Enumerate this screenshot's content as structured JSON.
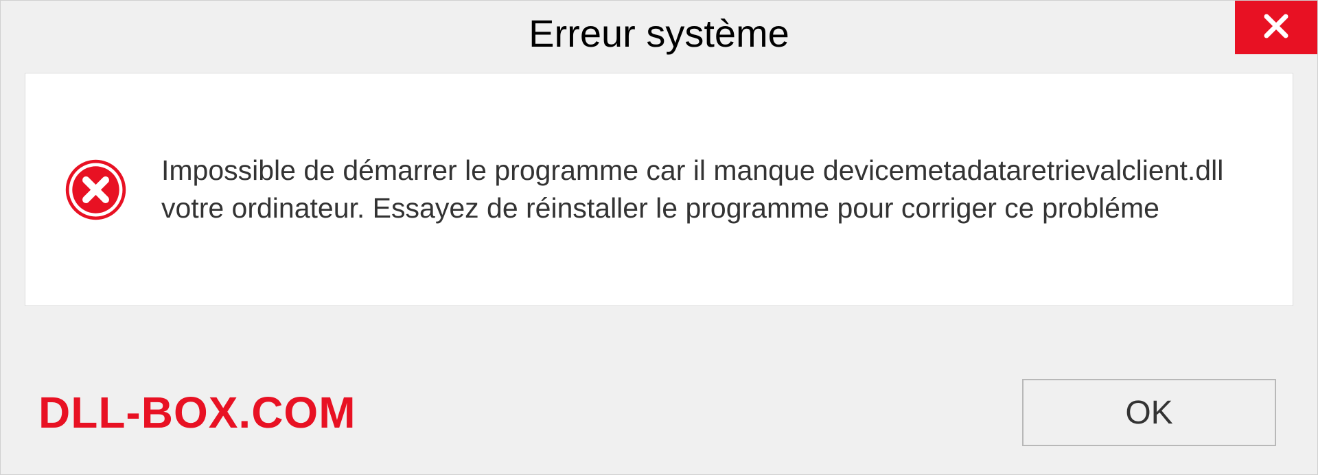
{
  "titlebar": {
    "title": "Erreur système"
  },
  "content": {
    "message": "Impossible de démarrer le programme car il manque devicemetadataretrievalclient.dll votre ordinateur. Essayez de réinstaller le programme pour corriger ce probléme"
  },
  "footer": {
    "watermark": "DLL-BOX.COM",
    "ok_label": "OK"
  },
  "icons": {
    "close": "close-icon",
    "error": "error-icon"
  },
  "colors": {
    "accent_red": "#e81123",
    "background": "#f0f0f0",
    "panel": "#ffffff"
  }
}
